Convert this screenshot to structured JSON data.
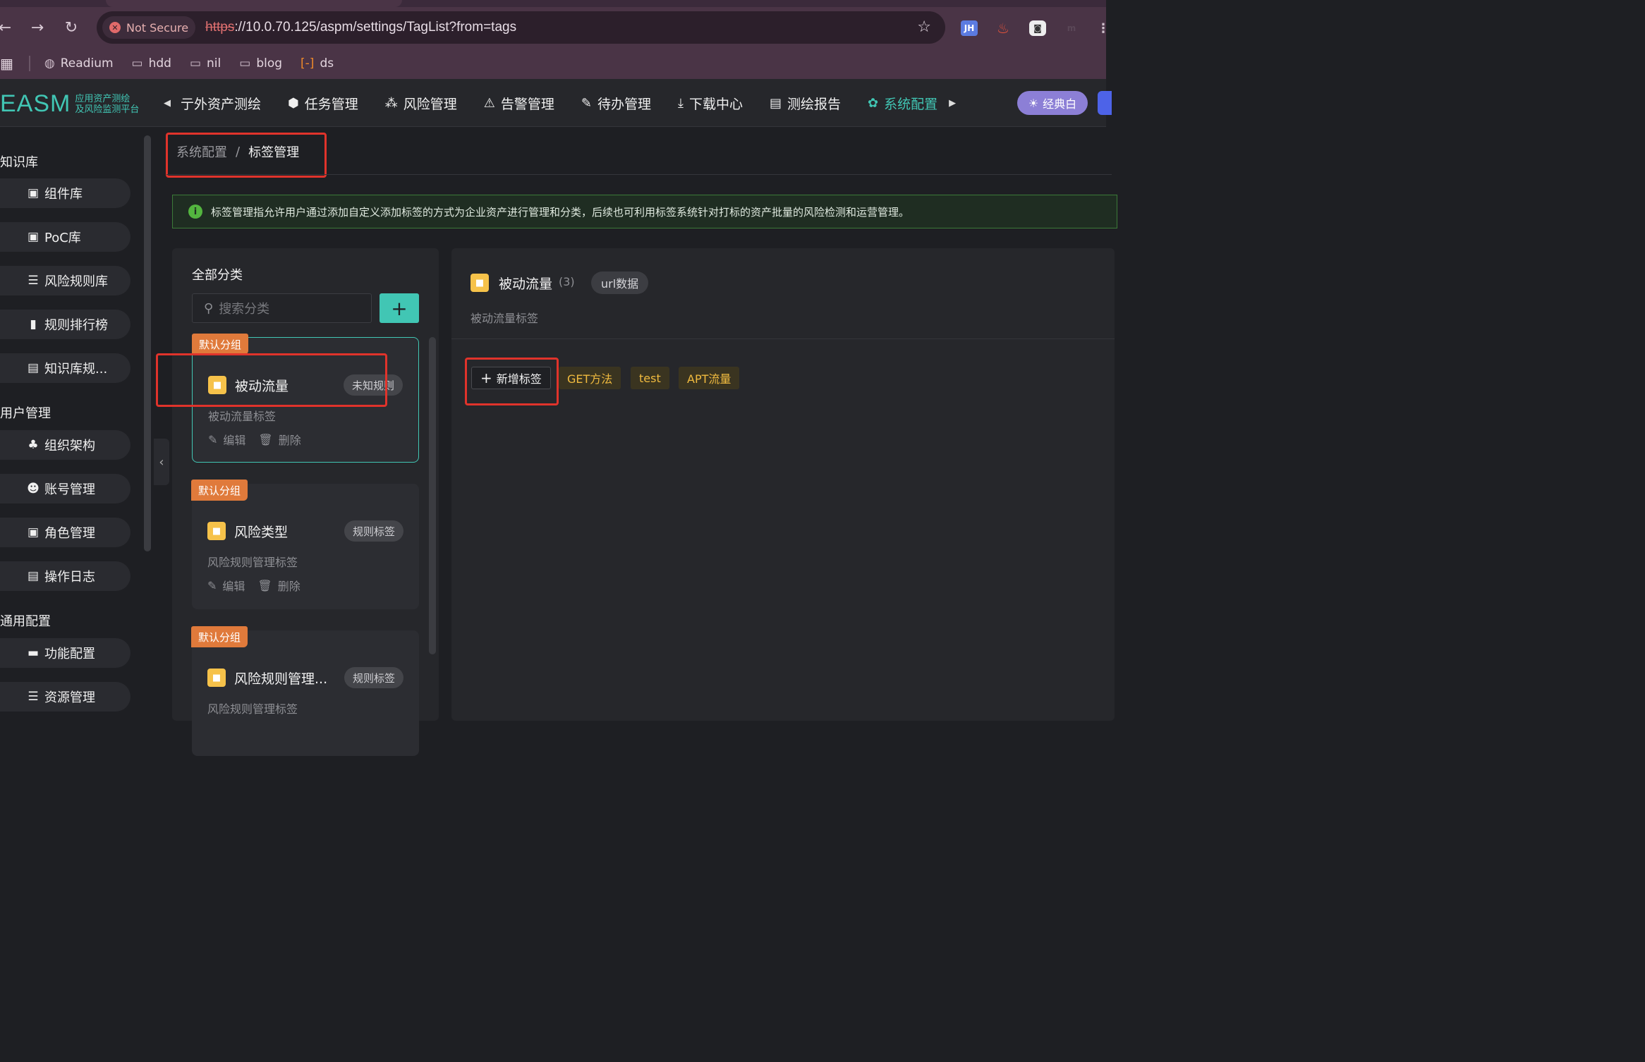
{
  "browser": {
    "security_label": "Not Secure",
    "url_scheme": "https",
    "url_rest": "://10.0.70.125/aspm/settings/TagList?from=tags",
    "extensions": [
      "JH"
    ],
    "bookmarks": [
      {
        "label": "Readium",
        "icon": "globe-icon"
      },
      {
        "label": "hdd",
        "icon": "folder-icon"
      },
      {
        "label": "nil",
        "icon": "folder-icon"
      },
      {
        "label": "blog",
        "icon": "folder-icon"
      },
      {
        "label": "ds",
        "icon": "code-bracket-icon"
      }
    ]
  },
  "app": {
    "logo_text": "EASM",
    "logo_sub1": "应用资产测绘",
    "logo_sub2": "及风险监测平台",
    "nav": [
      {
        "label": "亍外资产测绘",
        "icon": "arrow-left-icon"
      },
      {
        "label": "任务管理",
        "icon": "cube-icon"
      },
      {
        "label": "风险管理",
        "icon": "nodes-icon"
      },
      {
        "label": "告警管理",
        "icon": "alarm-icon"
      },
      {
        "label": "待办管理",
        "icon": "todo-icon"
      },
      {
        "label": "下载中心",
        "icon": "download-icon"
      },
      {
        "label": "测绘报告",
        "icon": "report-icon"
      },
      {
        "label": "系统配置",
        "icon": "gear-icon",
        "active": true
      }
    ],
    "theme_label": "经典白",
    "accent": "#41c6b4"
  },
  "sidebar": {
    "groups": [
      {
        "title": "知识库",
        "items": [
          "组件库",
          "PoC库",
          "风险规则库",
          "规则排行榜",
          "知识库规..."
        ]
      },
      {
        "title": "用户管理",
        "items": [
          "组织架构",
          "账号管理",
          "角色管理",
          "操作日志"
        ]
      },
      {
        "title": "通用配置",
        "items": [
          "功能配置",
          "资源管理"
        ]
      }
    ]
  },
  "breadcrumb": {
    "parent": "系统配置",
    "sep": "/",
    "current": "标签管理"
  },
  "info": "标签管理指允许用户通过添加自定义添加标签的方式为企业资产进行管理和分类，后续也可利用标签系统针对打标的资产批量的风险检测和运营管理。",
  "left": {
    "title": "全部分类",
    "search_placeholder": "搜索分类",
    "cards": [
      {
        "group": "默认分组",
        "name": "被动流量",
        "pill": "未知规则",
        "desc": "被动流量标签",
        "edit": "编辑",
        "delete": "删除"
      },
      {
        "group": "默认分组",
        "name": "风险类型",
        "pill": "规则标签",
        "desc": "风险规则管理标签",
        "edit": "编辑",
        "delete": "删除"
      },
      {
        "group": "默认分组",
        "name": "风险规则管理...",
        "pill": "规则标签",
        "desc": "风险规则管理标签"
      }
    ]
  },
  "right": {
    "name": "被动流量",
    "count": "(3)",
    "pill": "url数据",
    "desc": "被动流量标签",
    "new_tag": "新增标签",
    "tags": [
      "GET方法",
      "test",
      "APT流量"
    ]
  }
}
